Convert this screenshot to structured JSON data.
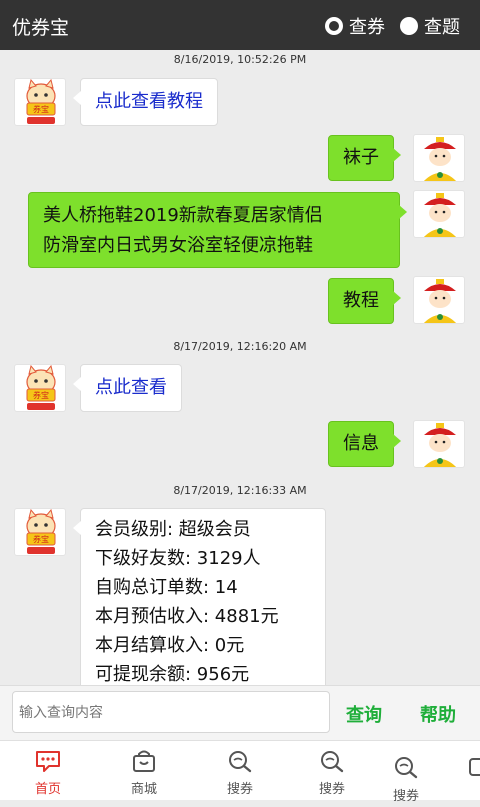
{
  "header": {
    "title": "优券宝",
    "modes": [
      {
        "label": "查券",
        "checked": true
      },
      {
        "label": "查题",
        "checked": false
      }
    ]
  },
  "chat": {
    "timestamps": [
      "8/16/2019, 10:52:26 PM",
      "8/17/2019, 12:16:20 AM",
      "8/17/2019, 12:16:33 AM"
    ],
    "bot_link_1": "点此查看教程",
    "user_msg_1": "袜子",
    "user_msg_2_line1": "美人桥拖鞋2019新款春夏居家情侣",
    "user_msg_2_line2": "防滑室内日式男女浴室轻便凉拖鞋",
    "user_msg_3": "教程",
    "bot_link_2": "点此查看",
    "user_msg_4": "信息",
    "info_lines": [
      "会员级别: 超级会员",
      "下级好友数: 3129人",
      "自购总订单数: 14",
      "本月预估收入: 4881元",
      "本月结算收入: 0元",
      "可提现余额: 956元"
    ],
    "bot_avatar_text": "券宝"
  },
  "input": {
    "placeholder": "输入查询内容",
    "query_label": "查询",
    "help_label": "帮助"
  },
  "tabs": [
    {
      "label": "首页",
      "active": true
    },
    {
      "label": "商城",
      "active": false
    },
    {
      "label": "搜券",
      "active": false
    },
    {
      "label": "搜券",
      "active": false
    },
    {
      "label": "搜券",
      "active": false
    }
  ],
  "colors": {
    "header_bg": "#333333",
    "user_bubble": "#7ee02c",
    "link_text": "#1a2ccc",
    "action_green": "#1fae3a",
    "active_tab": "#e0332d"
  }
}
